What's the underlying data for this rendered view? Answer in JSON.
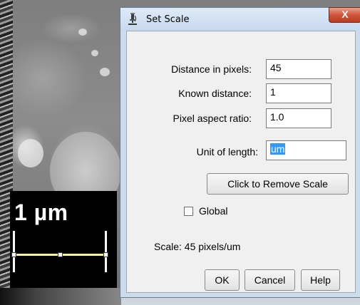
{
  "background_image": {
    "scale_bar_label": "1 µm"
  },
  "dialog": {
    "title": "Set Scale",
    "close_label": "X",
    "fields": {
      "distance_in_pixels": {
        "label": "Distance in pixels:",
        "value": "45"
      },
      "known_distance": {
        "label": "Known distance:",
        "value": "1"
      },
      "pixel_aspect_ratio": {
        "label": "Pixel aspect ratio:",
        "value": "1.0"
      },
      "unit_of_length": {
        "label": "Unit of length:",
        "value": "um"
      }
    },
    "remove_scale_button": "Click to Remove Scale",
    "global_checkbox": {
      "label": "Global",
      "checked": false
    },
    "scale_info": "Scale: 45 pixels/um",
    "buttons": {
      "ok": "OK",
      "cancel": "Cancel",
      "help": "Help"
    }
  },
  "colors": {
    "titlebar": "#c7d9ee",
    "close_button": "#d0553a",
    "selection": "#3399ff",
    "dialog_body": "#f0f0f0"
  }
}
